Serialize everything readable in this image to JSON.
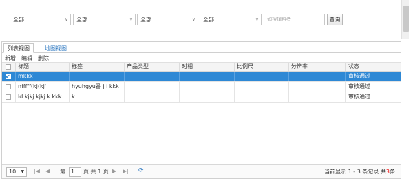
{
  "filters": {
    "selects": [
      "全部",
      "全部",
      "全部",
      "全部"
    ],
    "search_placeholder": "如搜择料者",
    "query_label": "查询"
  },
  "tabs": [
    {
      "label": "列表视图"
    },
    {
      "label": "地图视图"
    }
  ],
  "toolbar": {
    "add_label": "新增",
    "edit_label": "编辑",
    "delete_label": "删除"
  },
  "table": {
    "columns": [
      "标题",
      "标签",
      "产品类型",
      "时相",
      "比例尺",
      "分辨率",
      "状态"
    ],
    "rows": [
      {
        "title": "mkkk",
        "tag": "",
        "product_type": "",
        "time": "",
        "scale": "",
        "resolution": "",
        "status": "审核通过",
        "selected": true
      },
      {
        "title": "nfffff(kj(kj'",
        "tag": "hyuhgyu番 j i  kkk",
        "product_type": "",
        "time": "",
        "scale": "",
        "resolution": "",
        "status": "审核通过",
        "selected": false
      },
      {
        "title": "ld kjkj kjkj k kkk",
        "tag": "k",
        "product_type": "",
        "time": "",
        "scale": "",
        "resolution": "",
        "status": "审核通过",
        "selected": false
      }
    ]
  },
  "pager": {
    "page_size": "10",
    "page_prefix": "第",
    "page_value": "1",
    "page_suffix": "页 共 1 页",
    "info_prefix": "当前显示 1 - 3 条记录 共",
    "info_count": "3",
    "info_suffix": "条"
  }
}
